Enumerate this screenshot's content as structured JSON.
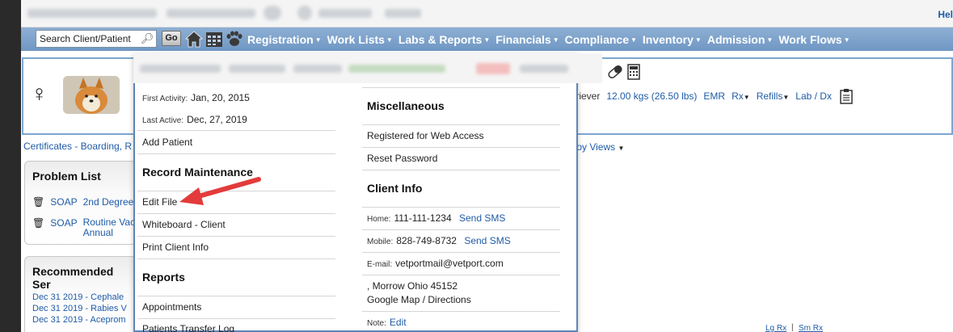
{
  "header": {
    "help_label": "Hel"
  },
  "search": {
    "placeholder": "Search Client/Patient",
    "go_label": "Go"
  },
  "nav": {
    "menus": [
      "Registration",
      "Work Lists",
      "Labs & Reports",
      "Financials",
      "Compliance",
      "Inventory",
      "Admission",
      "Work Flows"
    ]
  },
  "patient": {
    "weight_prefix": "triever",
    "weight": "12.00 kgs (26.50 lbs)",
    "links": [
      "EMR",
      "Rx",
      "Refills",
      "Lab / Dx"
    ]
  },
  "certs_label": "Certificates - Boarding, R",
  "views_label": "lloy Views",
  "problem_list": {
    "title": "Problem List",
    "items": [
      {
        "tag": "SOAP",
        "text": "2nd Degree"
      },
      {
        "tag": "SOAP",
        "text": "Routine Vac",
        "text2": "Annual"
      }
    ]
  },
  "recommended": {
    "title": "Recommended Ser",
    "items": [
      "Dec 31 2019 - Cephale",
      "Dec 31 2019 - Rabies V",
      "Dec 31 2019 - Aceprom"
    ]
  },
  "popup": {
    "first_activity_label": "First Activity:",
    "first_activity": "Jan, 20, 2015",
    "last_active_label": "Last Active:",
    "last_active": "Dec, 27, 2019",
    "add_patient": "Add Patient",
    "record_maintenance": "Record Maintenance",
    "edit_file": "Edit File",
    "whiteboard": "Whiteboard - Client",
    "print_client_info": "Print Client Info",
    "reports": "Reports",
    "appointments": "Appointments",
    "patients_transfer_log": "Patients Transfer Log",
    "misc_title": "Miscellaneous",
    "registered": "Registered for Web Access",
    "reset_password": "Reset Password",
    "client_info_title": "Client Info",
    "home_label": "Home:",
    "home_phone": "111-111-1234",
    "mobile_label": "Mobile:",
    "mobile_phone": "828-749-8732",
    "send_sms": "Send SMS",
    "email_label": "E-mail:",
    "email": "vetportmail@vetport.com",
    "address": ", Morrow Ohio 45152",
    "google_map": "Google Map / Directions",
    "note_label": "Note:",
    "note_edit": "Edit"
  },
  "footer": {
    "lg_rx": "Lg Rx",
    "divider": "|",
    "sm_rx": "Sm Rx"
  },
  "colors": {
    "nav_bg": "#7da3cc",
    "link": "#1f5ca8",
    "arrow": "#e33b3b",
    "popup_border": "#5e86b7"
  }
}
